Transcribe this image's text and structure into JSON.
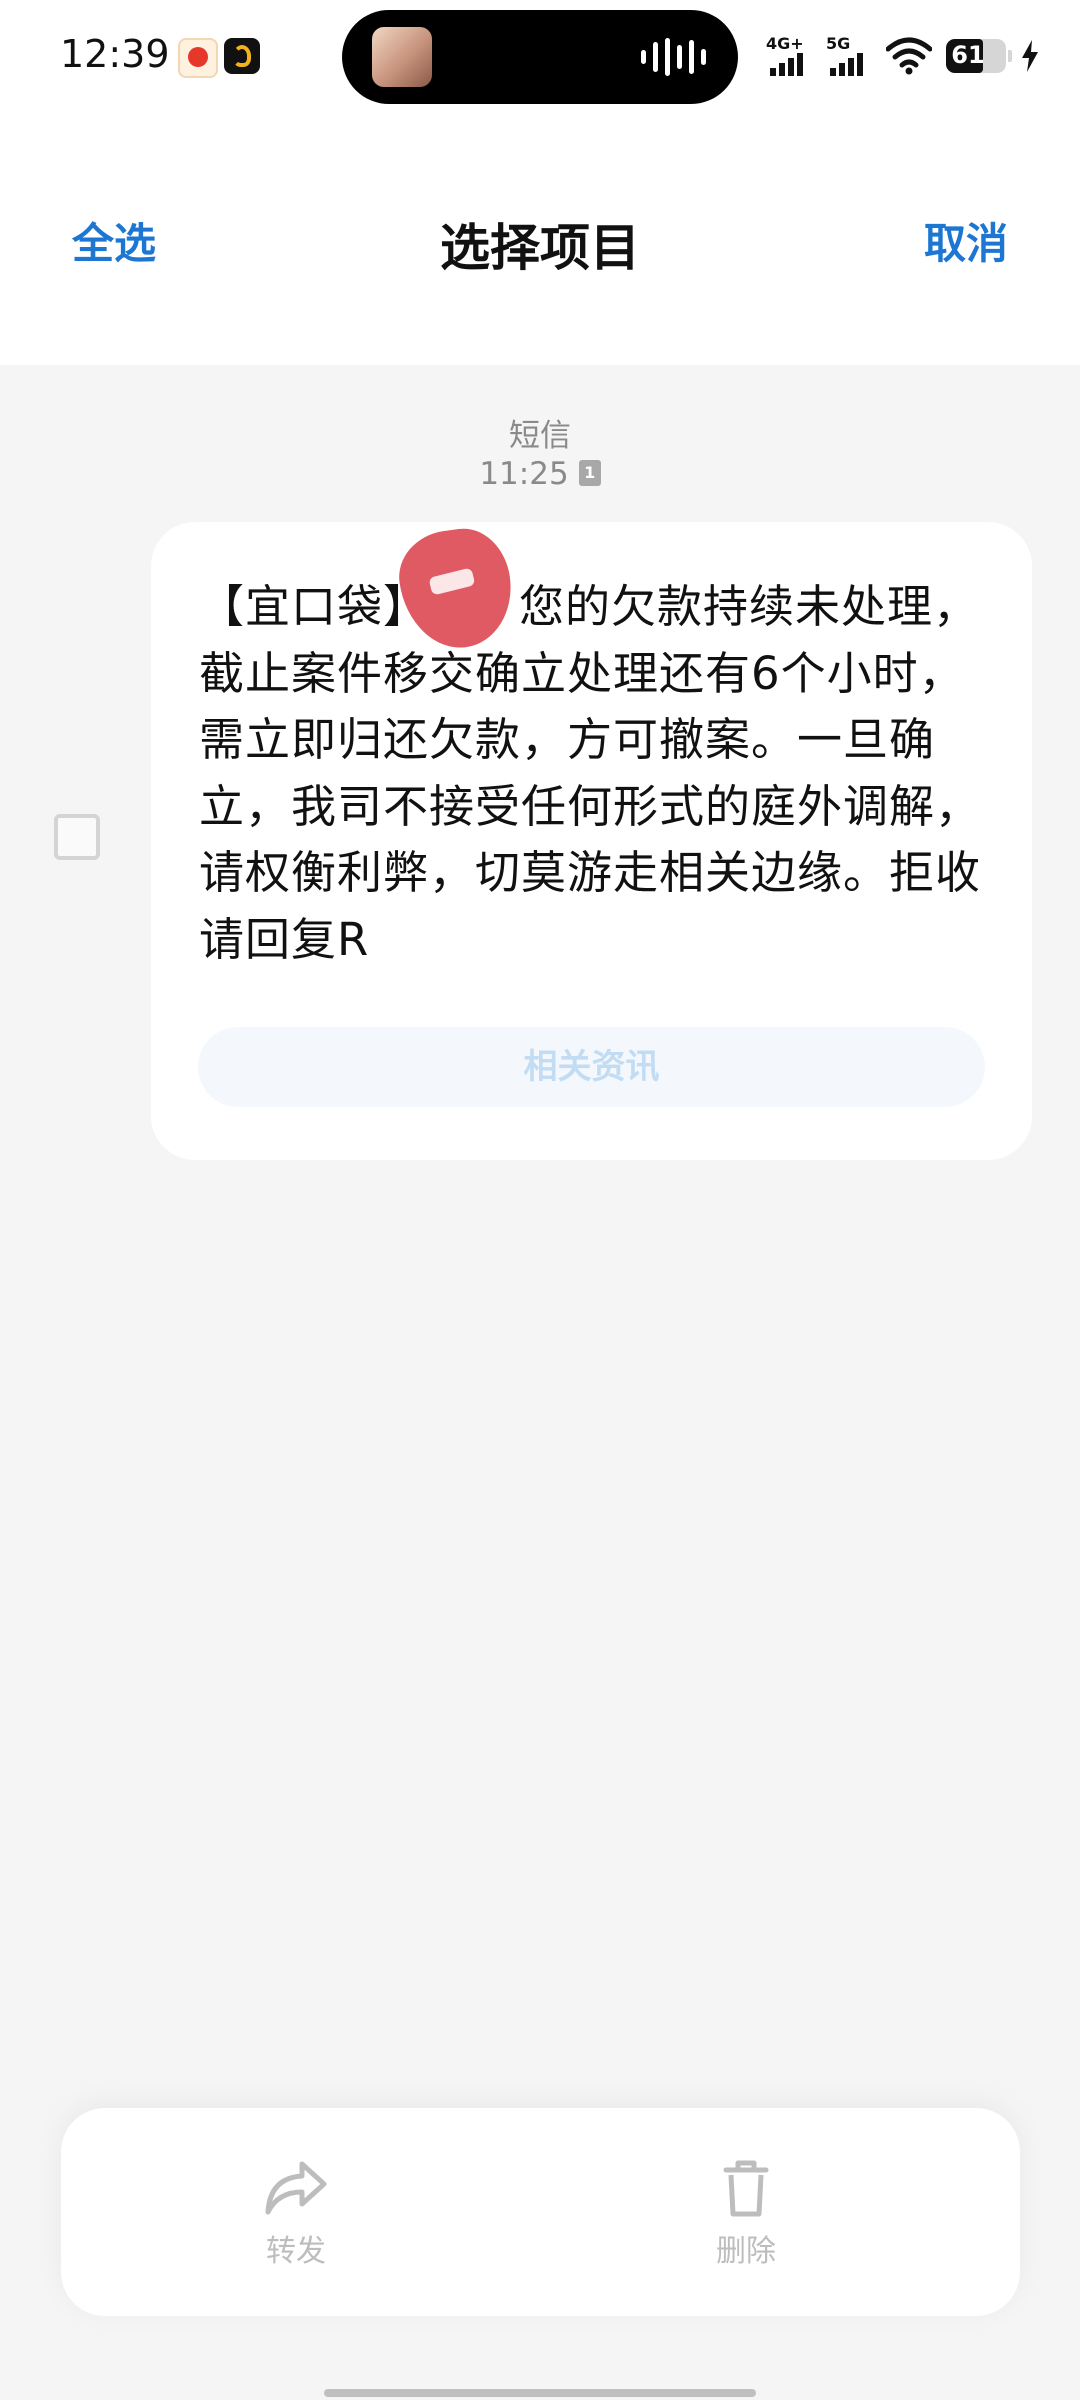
{
  "status_bar": {
    "time": "12:39",
    "network_1": "4G+",
    "network_2": "5G",
    "battery_percent": "61"
  },
  "header": {
    "select_all": "全选",
    "title": "选择项目",
    "cancel": "取消"
  },
  "message": {
    "channel_label": "短信",
    "time": "11:25",
    "sim_number": "1",
    "body_prefix": "【宜口袋】",
    "body_text": "您的欠款持续未处理，截止案件移交确立处理还有6个小时，需立即归还欠款，方可撤案。一旦确立，我司不接受任何形式的庭外调解，请权衡利弊，切莫游走相关边缘。拒收请回复R",
    "related_button": "相关资讯"
  },
  "actions": {
    "forward": "转发",
    "delete": "删除"
  },
  "icons": {
    "forward": "forward-icon",
    "delete": "trash-icon",
    "checkbox": "checkbox-unchecked",
    "sim": "sim-badge-icon"
  },
  "colors": {
    "accent": "#1d77d2",
    "background": "#f5f5f5",
    "redaction": "#e05a64"
  }
}
